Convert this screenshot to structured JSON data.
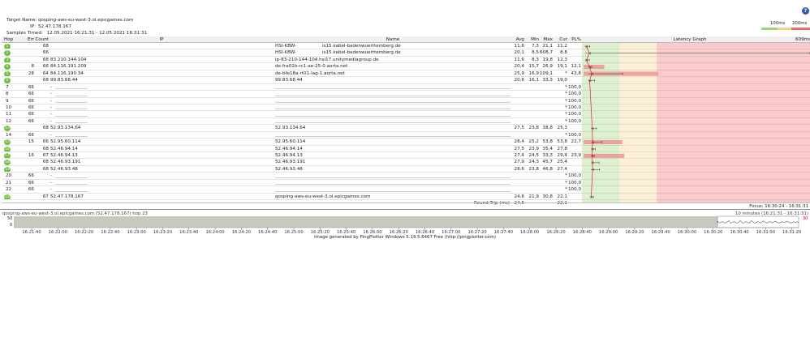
{
  "header": {
    "target_label": "Target Name:",
    "target_value": "qosping-aws-eu-west-3.ol.epicgames.com",
    "ip_label": "IP:",
    "ip_value": "52.47.178.167",
    "samples_label": "Samples Timed:",
    "samples_value": "12.05.2021 16:21:31 - 12.05.2021 16:31:31"
  },
  "help_icon": "?",
  "legend": {
    "label_100": "100ms",
    "label_200": "200ms",
    "colors": [
      "#9fd37c",
      "#f5d18c",
      "#ef6a6a"
    ]
  },
  "columns": {
    "hop": "Hop",
    "err": "Err",
    "count": "Count",
    "ip": "IP",
    "name": "Name",
    "avg": "Avg",
    "min": "Min",
    "max": "Max",
    "cur": "Cur",
    "pl": "PL%",
    "graph": "Latency Graph",
    "graph_max": "609ms"
  },
  "rows": [
    {
      "hop": "1",
      "badge": true,
      "err": "",
      "count": "68",
      "ip": "",
      "name": "HSI-KBW-",
      "name2": "­­­­­­­­­­­­­­­­­­­­­­­­­­­­­­­­­­­­­­­­­­­­­­­­­­­­­­­­­­­­­­­­­­­­­­­­­­­­­­­­­­­­­­­­­­­­­­­­­­­­­is15.kabel-badenwuerttemberg.de",
      "avg": "11,6",
      "min": "7,3",
      "max": "21,1",
      "cur": "11,2",
      "pl": "",
      "plr": 0,
      "bar": 0
    },
    {
      "hop": "2",
      "badge": true,
      "err": "",
      "count": "66",
      "ip": "",
      "name": "HSI-KBW-",
      "name2": "is15.kabel-badenwuerttemberg.de",
      "avg": "20,1",
      "min": "8,5",
      "max": "608,7",
      "cur": "8,8",
      "pl": "",
      "plr": 0,
      "bar": 0
    },
    {
      "hop": "3",
      "badge": true,
      "err": "",
      "count": "68",
      "ip": "83.210.144.104",
      "name": "ip-83-210-144-104.hsi17.unitymediagroup.de",
      "name2": "",
      "avg": "11,6",
      "min": "8,3",
      "max": "19,8",
      "cur": "12,3",
      "pl": "",
      "plr": 0,
      "bar": 0
    },
    {
      "hop": "4",
      "badge": true,
      "err": "8",
      "count": "66",
      "ip": "84.116.191.209",
      "name": "de-fra01b-rc1-ae-25-0.aorta.net",
      "name2": "",
      "avg": "20,4",
      "min": "15,7",
      "max": "26,9",
      "cur": "19,1",
      "pl": "12,1",
      "plr": 12.1,
      "bar": 0
    },
    {
      "hop": "5",
      "badge": true,
      "err": "28",
      "count": "64",
      "ip": "84.116.190.34",
      "name": "de-bfe18a-rt01-lag-1.aorta.net",
      "name2": "",
      "avg": "25,9",
      "min": "16,9",
      "max": "109,1",
      "cur": "*",
      "pl": "43,8",
      "plr": 43.8,
      "bar": 0
    },
    {
      "hop": "6",
      "badge": true,
      "err": "",
      "count": "68",
      "ip": "99.83.68.44",
      "name": "99.83.68.44",
      "name2": "",
      "avg": "20,6",
      "min": "16,1",
      "max": "33,3",
      "cur": "19,0",
      "pl": "",
      "plr": 0,
      "bar": 0
    },
    {
      "hop": "7",
      "badge": false,
      "err": "66",
      "count": "",
      "ip": "-",
      "name": "",
      "name2": "",
      "avg": "",
      "min": "",
      "max": "",
      "cur": "*",
      "pl": "100,0",
      "plr": 100,
      "bar": 0
    },
    {
      "hop": "8",
      "badge": false,
      "err": "66",
      "count": "",
      "ip": "-",
      "name": "",
      "name2": "",
      "avg": "",
      "min": "",
      "max": "",
      "cur": "*",
      "pl": "100,0",
      "plr": 100,
      "bar": 0
    },
    {
      "hop": "9",
      "badge": false,
      "err": "66",
      "count": "",
      "ip": "-",
      "name": "",
      "name2": "",
      "avg": "",
      "min": "",
      "max": "",
      "cur": "*",
      "pl": "100,0",
      "plr": 100,
      "bar": 0
    },
    {
      "hop": "10",
      "badge": false,
      "err": "66",
      "count": "",
      "ip": "-",
      "name": "",
      "name2": "",
      "avg": "",
      "min": "",
      "max": "",
      "cur": "*",
      "pl": "100,0",
      "plr": 100,
      "bar": 0
    },
    {
      "hop": "11",
      "badge": false,
      "err": "66",
      "count": "",
      "ip": "-",
      "name": "",
      "name2": "",
      "avg": "",
      "min": "",
      "max": "",
      "cur": "*",
      "pl": "100,0",
      "plr": 100,
      "bar": 0
    },
    {
      "hop": "12",
      "badge": false,
      "err": "66",
      "count": "",
      "ip": "-",
      "name": "",
      "name2": "",
      "avg": "",
      "min": "",
      "max": "",
      "cur": "*",
      "pl": "100,0",
      "plr": 100,
      "bar": 0
    },
    {
      "hop": "13",
      "badge": true,
      "err": "",
      "count": "68",
      "ip": "52.93.134.64",
      "name": "52.93.134.64",
      "name2": "",
      "avg": "27,5",
      "min": "23,8",
      "max": "38,8",
      "cur": "25,3",
      "pl": "",
      "plr": 0,
      "bar": 0
    },
    {
      "hop": "14",
      "badge": false,
      "err": "66",
      "count": "",
      "ip": "-",
      "name": "",
      "name2": "",
      "avg": "",
      "min": "",
      "max": "",
      "cur": "*",
      "pl": "100,0",
      "plr": 100,
      "bar": 0
    },
    {
      "hop": "15",
      "badge": true,
      "err": "15",
      "count": "66",
      "ip": "52.95.60.114",
      "name": "52.95.60.114",
      "name2": "",
      "avg": "28,4",
      "min": "25,2",
      "max": "53,8",
      "cur": "53,8",
      "pl": "22,7",
      "plr": 22.7,
      "bar": 0
    },
    {
      "hop": "16",
      "badge": true,
      "err": "",
      "count": "68",
      "ip": "52.46.94.14",
      "name": "52.46.94.14",
      "name2": "",
      "avg": "27,5",
      "min": "23,9",
      "max": "35,4",
      "cur": "27,8",
      "pl": "",
      "plr": 0,
      "bar": 0
    },
    {
      "hop": "17",
      "badge": true,
      "err": "16",
      "count": "67",
      "ip": "52.46.94.13",
      "name": "52.46.94.13",
      "name2": "",
      "avg": "27,4",
      "min": "24,5",
      "max": "33,3",
      "cur": "29,4",
      "pl": "23,9",
      "plr": 23.9,
      "bar": 0
    },
    {
      "hop": "18",
      "badge": true,
      "err": "",
      "count": "68",
      "ip": "52.46.93.191",
      "name": "52.46.93.191",
      "name2": "",
      "avg": "27,9",
      "min": "24,3",
      "max": "45,7",
      "cur": "25,4",
      "pl": "",
      "plr": 0,
      "bar": 0
    },
    {
      "hop": "19",
      "badge": true,
      "err": "",
      "count": "68",
      "ip": "52.46.93.48",
      "name": "52.46.93.48",
      "name2": "",
      "avg": "28,6",
      "min": "23,8",
      "max": "46,8",
      "cur": "27,4",
      "pl": "",
      "plr": 0,
      "bar": 0
    },
    {
      "hop": "20",
      "badge": false,
      "err": "66",
      "count": "",
      "ip": "-",
      "name": "",
      "name2": "",
      "avg": "",
      "min": "",
      "max": "",
      "cur": "*",
      "pl": "100,0",
      "plr": 100,
      "bar": 0
    },
    {
      "hop": "21",
      "badge": false,
      "err": "66",
      "count": "",
      "ip": "-",
      "name": "",
      "name2": "",
      "avg": "",
      "min": "",
      "max": "",
      "cur": "*",
      "pl": "100,0",
      "plr": 100,
      "bar": 0
    },
    {
      "hop": "22",
      "badge": false,
      "err": "66",
      "count": "",
      "ip": "-",
      "name": "",
      "name2": "",
      "avg": "",
      "min": "",
      "max": "",
      "cur": "*",
      "pl": "100,0",
      "plr": 100,
      "bar": 0
    },
    {
      "hop": "23",
      "badge": true,
      "err": "",
      "count": "67",
      "ip": "52.47.178.167",
      "name": "qosping-aws-eu-west-3.ol.epicgames.com",
      "name2": "",
      "avg": "24,6",
      "min": "21,9",
      "max": "30,8",
      "cur": "22,1",
      "pl": "",
      "plr": 0,
      "bar": 0
    }
  ],
  "round_trip": {
    "label": "Round Trip (ms)",
    "avg": "24,6",
    "cur": "22,1"
  },
  "focus": "Focus: 16:30:24 - 16:31:31",
  "timeline": {
    "title": "qosping-aws-eu-west-3.ol.epicgames.com (52.47.178.167) hop 23",
    "duration": "10 minutes (16:21:31 - 16:31:31)",
    "y_top": "50",
    "y_bottom": "0",
    "y_right": "30",
    "ticks": [
      "16:21:40",
      "16:22:00",
      "16:22:20",
      "16:22:40",
      "16:23:00",
      "16:23:20",
      "16:23:40",
      "16:24:00",
      "16:24:20",
      "16:24:40",
      "16:25:00",
      "16:25:20",
      "16:25:40",
      "16:26:00",
      "16:26:20",
      "16:26:40",
      "16:27:00",
      "16:27:20",
      "16:27:40",
      "16:28:00",
      "16:28:20",
      "16:28:40",
      "16:29:00",
      "16:29:20",
      "16:29:40",
      "16:30:00",
      "16:30:20",
      "16:30:40",
      "16:31:00",
      "16:31:20"
    ]
  },
  "caption": "Image generated by PingPlotter Windows 5.19.5.8467 Free (http://pingplotter.com)"
}
